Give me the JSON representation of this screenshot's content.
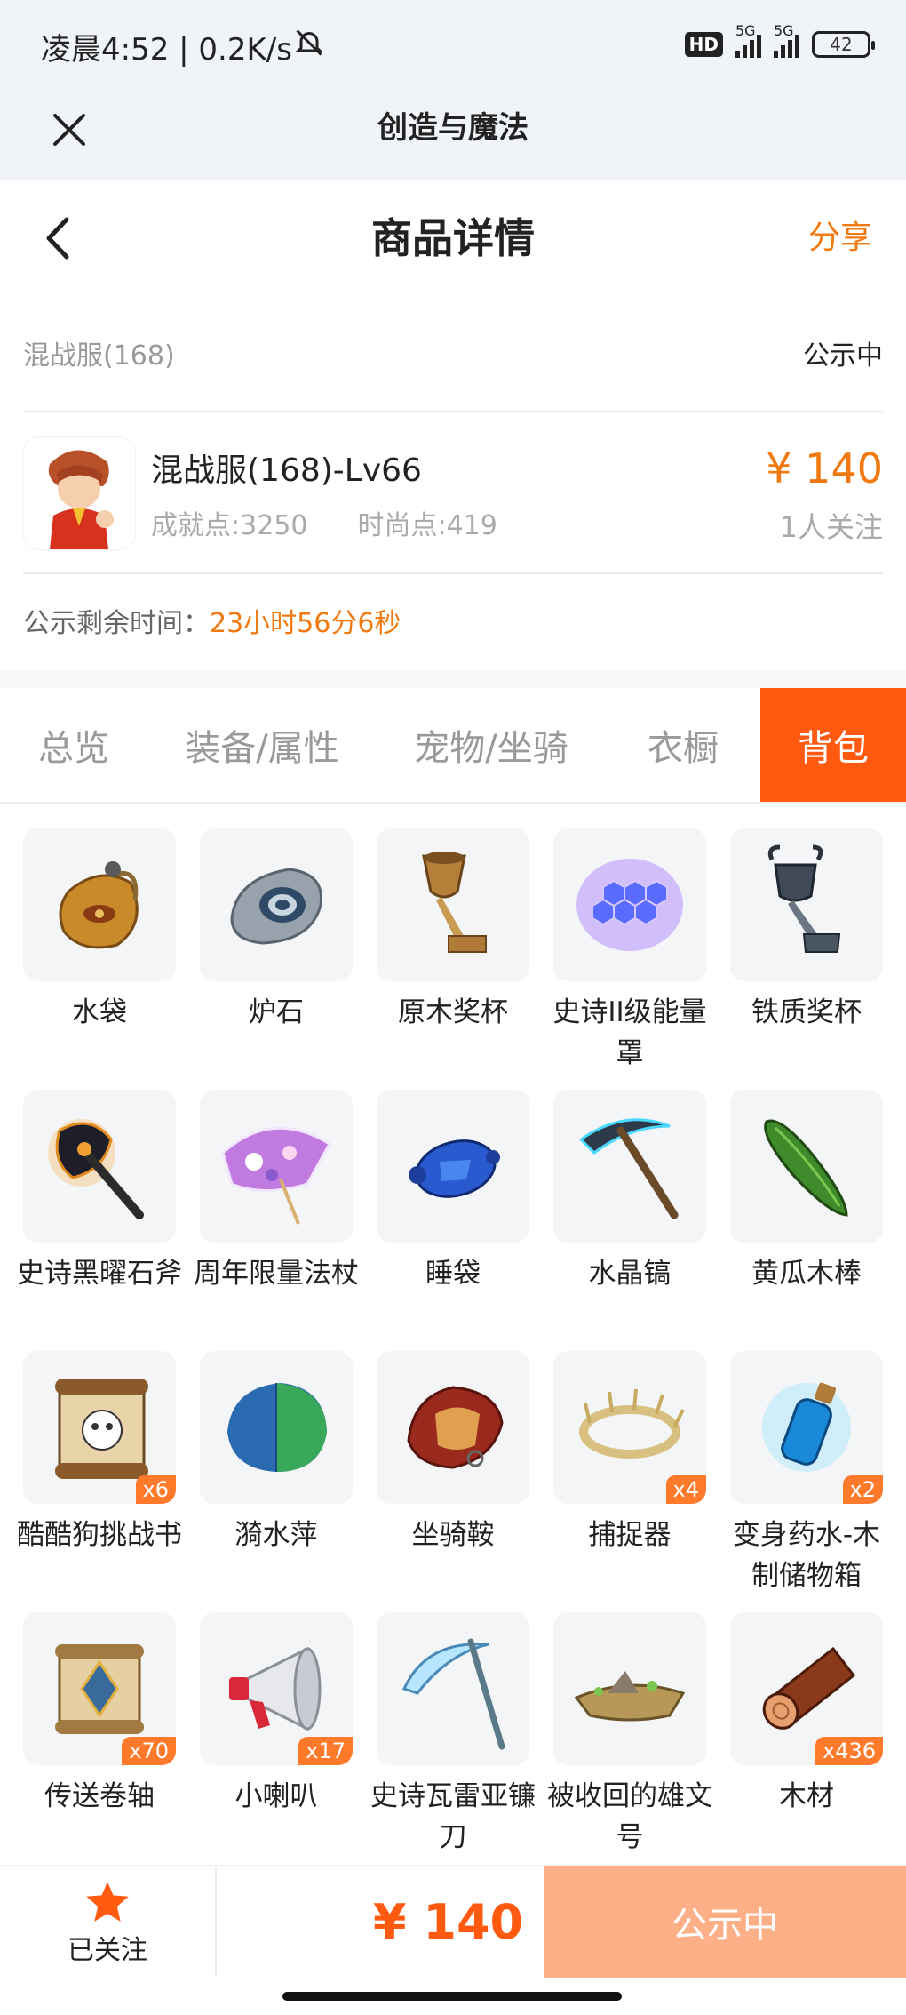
{
  "status_bar": {
    "time": "凌晨4:52 | 0.2K/s",
    "network_label": "HD",
    "signal1_label": "5G",
    "signal2_label": "5G",
    "battery": "42"
  },
  "mini_program": {
    "title": "创造与魔法"
  },
  "header": {
    "title": "商品详情",
    "share": "分享"
  },
  "product": {
    "server": "混战服(168)",
    "status": "公示中",
    "name": "混战服(168)-Lv66",
    "achievement": "成就点:3250",
    "fashion": "时尚点:419",
    "price": "¥ 140",
    "followers": "1人关注",
    "remain_label": "公示剩余时间：",
    "remain_time": "23小时56分6秒"
  },
  "tabs": [
    {
      "label": "总览"
    },
    {
      "label": "装备/属性"
    },
    {
      "label": "宠物/坐骑"
    },
    {
      "label": "衣橱"
    },
    {
      "label": "背包"
    }
  ],
  "active_tab": "背包",
  "items": [
    {
      "name": "水袋",
      "qty": ""
    },
    {
      "name": "炉石",
      "qty": ""
    },
    {
      "name": "原木奖杯",
      "qty": ""
    },
    {
      "name": "史诗II级能量罩",
      "qty": ""
    },
    {
      "name": "铁质奖杯",
      "qty": ""
    },
    {
      "name": "史诗黑曜石斧",
      "qty": ""
    },
    {
      "name": "周年限量法杖",
      "qty": ""
    },
    {
      "name": "睡袋",
      "qty": ""
    },
    {
      "name": "水晶镐",
      "qty": ""
    },
    {
      "name": "黄瓜木棒",
      "qty": ""
    },
    {
      "name": "酷酷狗挑战书",
      "qty": "x6"
    },
    {
      "name": "漪水萍",
      "qty": ""
    },
    {
      "name": "坐骑鞍",
      "qty": ""
    },
    {
      "name": "捕捉器",
      "qty": "x4"
    },
    {
      "name": "变身药水-木制储物箱",
      "qty": "x2"
    },
    {
      "name": "传送卷轴",
      "qty": "x70"
    },
    {
      "name": "小喇叭",
      "qty": "x17"
    },
    {
      "name": "史诗瓦雷亚镰刀",
      "qty": ""
    },
    {
      "name": "被收回的雄文号",
      "qty": ""
    },
    {
      "name": "木材",
      "qty": "x436"
    }
  ],
  "bottom": {
    "follow_label": "已关注",
    "price": "¥ 140",
    "action": "公示中"
  },
  "colors": {
    "accent": "#ff5a10",
    "price": "#f07a10",
    "button_disabled": "#fdb088"
  }
}
